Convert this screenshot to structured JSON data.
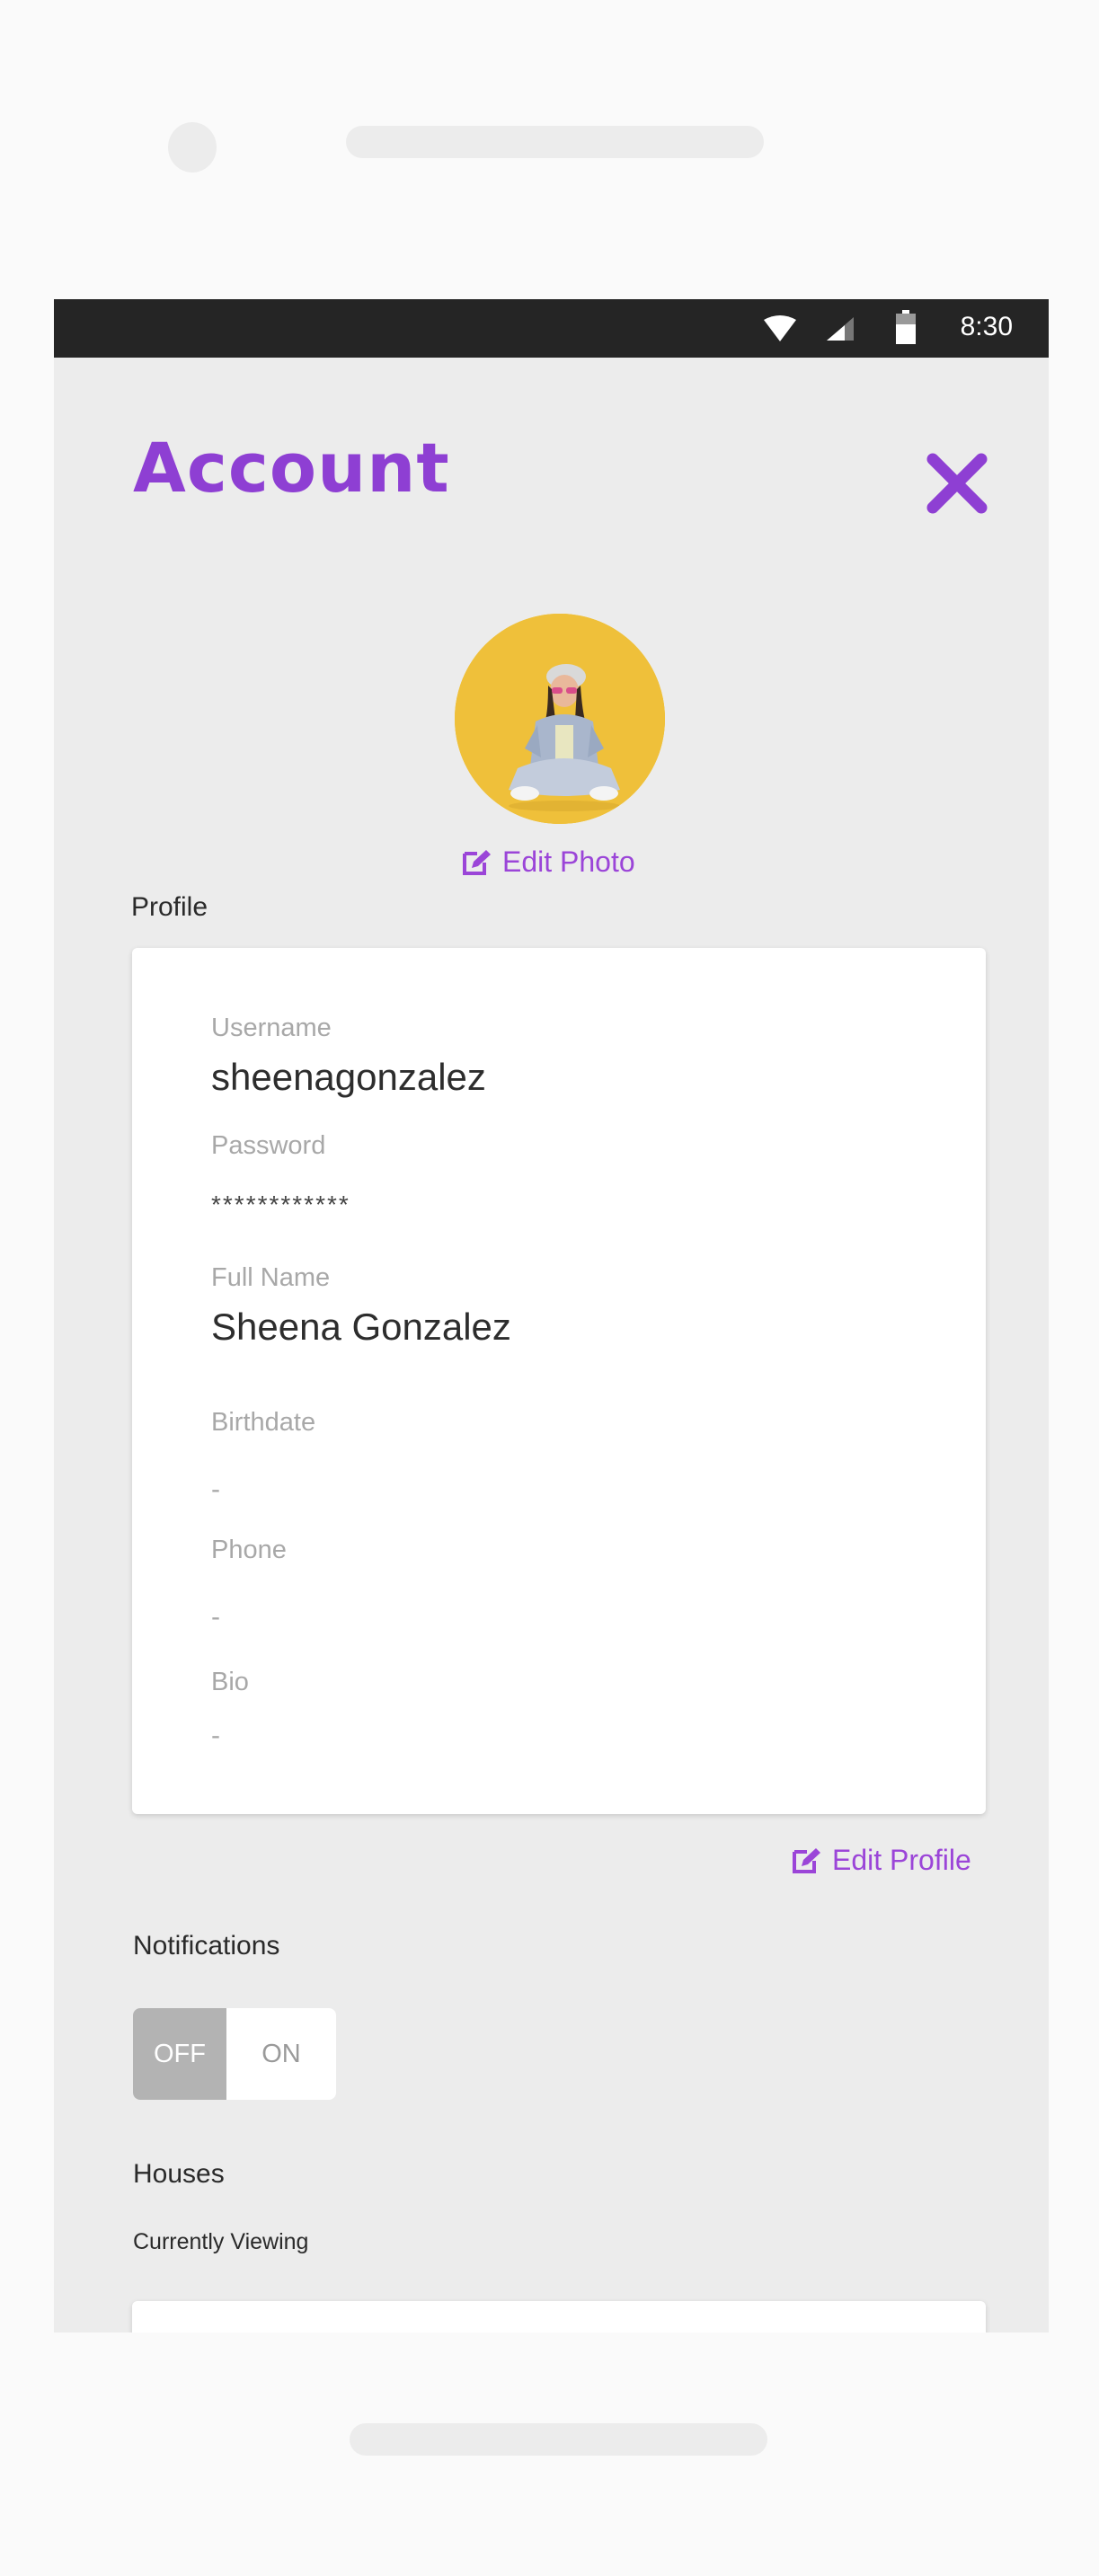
{
  "status_bar": {
    "time": "8:30",
    "icons": [
      "wifi-icon",
      "signal-icon",
      "battery-icon"
    ]
  },
  "header": {
    "title": "Account",
    "close_icon": "close-icon"
  },
  "avatar": {
    "alt": "profile-photo"
  },
  "edit_photo": {
    "label": "Edit Photo",
    "icon": "edit-icon"
  },
  "profile": {
    "section_label": "Profile",
    "fields": {
      "username": {
        "label": "Username",
        "value": "sheenagonzalez"
      },
      "password": {
        "label": "Password",
        "value": "************"
      },
      "full_name": {
        "label": "Full Name",
        "value": "Sheena Gonzalez"
      },
      "birthdate": {
        "label": "Birthdate",
        "value": "-"
      },
      "phone": {
        "label": "Phone",
        "value": "-"
      },
      "bio": {
        "label": "Bio",
        "value": "-"
      }
    },
    "edit_label": "Edit Profile"
  },
  "notifications": {
    "section_label": "Notifications",
    "off_label": "OFF",
    "on_label": "ON",
    "state": "OFF"
  },
  "houses": {
    "section_label": "Houses",
    "subsection_label": "Currently Viewing"
  },
  "colors": {
    "accent": "#8e3fd3",
    "status_bar": "#252525",
    "screen_bg": "#ececec"
  }
}
